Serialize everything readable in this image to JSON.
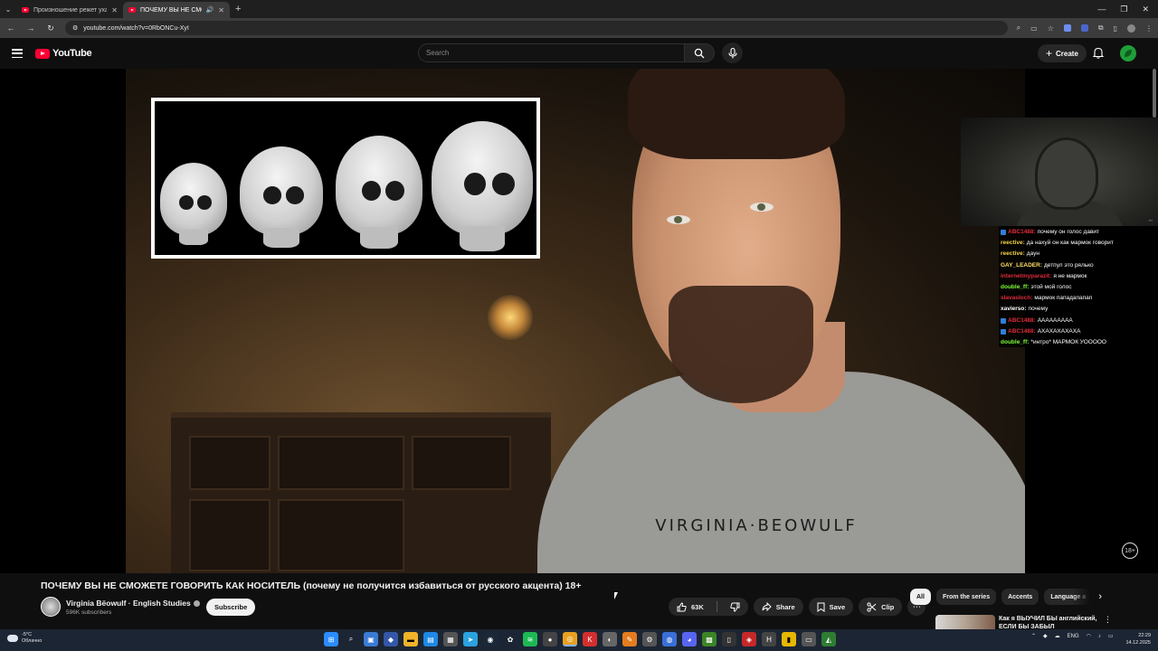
{
  "browser": {
    "tabs": [
      {
        "title": "Произношение режет уха: что",
        "active": false
      },
      {
        "title": "ПОЧЕМУ ВЫ НЕ СМОЖЕТЕ Г",
        "active": true
      }
    ],
    "url": "youtube.com/watch?v=0RbONCu-XyI"
  },
  "youtube": {
    "logo_text": "YouTube",
    "search_placeholder": "Search",
    "create_label": "Create"
  },
  "video": {
    "shirt_text": "VIRGINIA·BEOWULF",
    "age_badge": "18+"
  },
  "stream_chat": [
    {
      "user": "ABC1488",
      "message": "почему он голос давит",
      "user_color": "#e02b3a",
      "badge": true
    },
    {
      "user": "reective",
      "message": "да нахуй он как мармок говорит",
      "user_color": "#f5d547",
      "badge": false
    },
    {
      "user": "reective",
      "message": "даун",
      "user_color": "#f5d547",
      "badge": false
    },
    {
      "user": "GAY_LEADER",
      "message": "детпул это рялько",
      "user_color": "#ffe066",
      "badge": false
    },
    {
      "user": "internetmyparazit",
      "message": "я не мармок",
      "user_color": "#e02b3a",
      "badge": false
    },
    {
      "user": "double_ff",
      "message": "этой мой голос",
      "user_color": "#7fff3a",
      "badge": false
    },
    {
      "user": "slavasloch",
      "message": "мармок пападапапап",
      "user_color": "#e02b3a",
      "badge": false
    },
    {
      "user": "xavierso",
      "message": "почему",
      "user_color": "#ffffff",
      "badge": false
    },
    {
      "user": "ABC1488",
      "message": "ААААААААА",
      "user_color": "#e02b3a",
      "badge": true
    },
    {
      "user": "ABC1488",
      "message": "АХАХАХАХАХА",
      "user_color": "#e02b3a",
      "badge": true
    },
    {
      "user": "double_ff",
      "message": "*интро* МАРМОК УООООО",
      "user_color": "#7fff3a",
      "badge": false
    }
  ],
  "watch": {
    "title": "ПОЧЕМУ ВЫ НЕ СМОЖЕТЕ ГОВОРИТЬ КАК НОСИТЕЛЬ (почему не получится избавиться от русского акцента) 18+",
    "channel_name": "Virginia Bëowulf · English Studies",
    "subscribers": "596K subscribers",
    "subscribe_label": "Subscribe",
    "likes": "63K",
    "share_label": "Share",
    "save_label": "Save",
    "clip_label": "Clip"
  },
  "chips": [
    "All",
    "From the series",
    "Accents",
    "Language a"
  ],
  "recommendation": {
    "title": "Как я ВЫУЧИЛ БЫ английский, ЕСЛИ БЫ ЗАБЫЛ"
  },
  "taskbar": {
    "weather_temp": "-5°C",
    "weather_desc": "Облачно",
    "language": "ENG",
    "time": "22:29",
    "date": "14.12.2025"
  }
}
